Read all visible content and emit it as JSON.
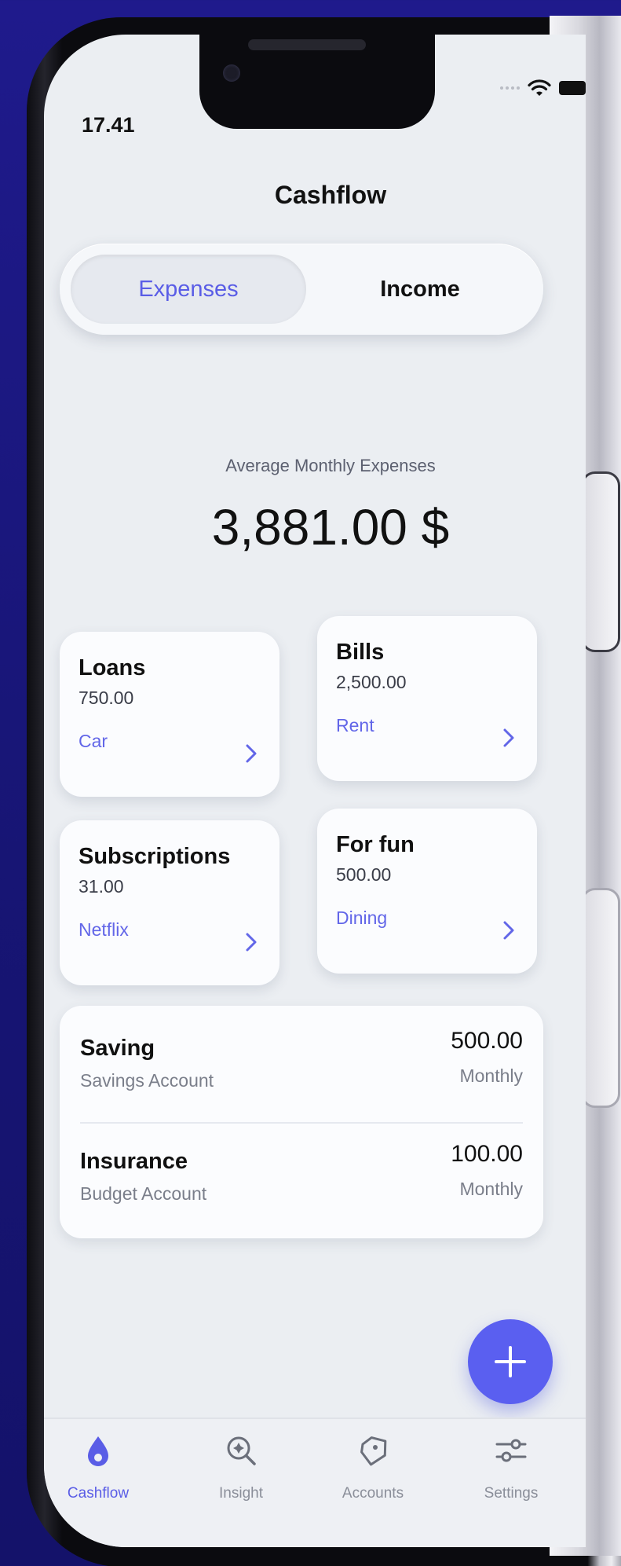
{
  "status": {
    "time": "17.41"
  },
  "header": {
    "title": "Cashflow"
  },
  "segment": {
    "active": "Expenses",
    "inactive": "Income"
  },
  "summary": {
    "label": "Average Monthly Expenses",
    "value": "3,881.00 $"
  },
  "cards": [
    {
      "title": "Loans",
      "amount": "750.00",
      "sub": "Car"
    },
    {
      "title": "Bills",
      "amount": "2,500.00",
      "sub": "Rent"
    },
    {
      "title": "Subscriptions",
      "amount": "31.00",
      "sub": "Netflix"
    },
    {
      "title": "For fun",
      "amount": "500.00",
      "sub": "Dining"
    }
  ],
  "list": [
    {
      "name": "Saving",
      "account": "Savings Account",
      "amount": "500.00",
      "frequency": "Monthly"
    },
    {
      "name": "Insurance",
      "account": "Budget Account",
      "amount": "100.00",
      "frequency": "Monthly"
    }
  ],
  "tabs": [
    {
      "label": "Cashflow",
      "icon": "drop-icon"
    },
    {
      "label": "Insight",
      "icon": "insight-icon"
    },
    {
      "label": "Accounts",
      "icon": "accounts-icon"
    },
    {
      "label": "Settings",
      "icon": "settings-icon"
    }
  ],
  "colors": {
    "accent": "#5A5FF0",
    "background": "#1A1680",
    "screen": "#EBEEF2"
  }
}
